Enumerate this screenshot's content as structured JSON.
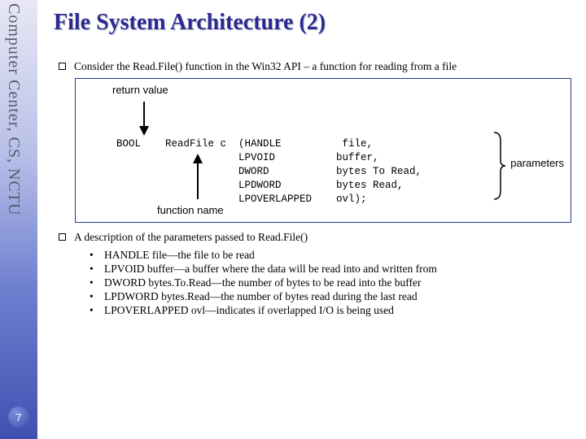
{
  "sidebar": {
    "org": "Computer Center, CS, NCTU",
    "page_number": "7"
  },
  "title": "File System Architecture (2)",
  "bullets": {
    "b1": "Consider the Read.File() function in the Win32 API – a function for reading from a file",
    "b2": "A description of the parameters passed to Read.File()"
  },
  "diagram": {
    "return_label": "return value",
    "funcname_label": "function name",
    "params_label": "parameters",
    "sig_l1": "BOOL    ReadFile c  (HANDLE          file,",
    "sig_l2": "                    LPVOID          buffer,",
    "sig_l3": "                    DWORD           bytes To Read,",
    "sig_l4": "                    LPDWORD         bytes Read,",
    "sig_l5": "                    LPOVERLAPPED    ovl);"
  },
  "params": {
    "p1": "HANDLE file—the file to be read",
    "p2": "LPVOID buffer—a buffer where the data will be read into and written from",
    "p3": "DWORD bytes.To.Read—the number of bytes to be read into the buffer",
    "p4": "LPDWORD bytes.Read—the number of bytes read during the last read",
    "p5": "LPOVERLAPPED ovl—indicates if overlapped I/O is being used"
  }
}
